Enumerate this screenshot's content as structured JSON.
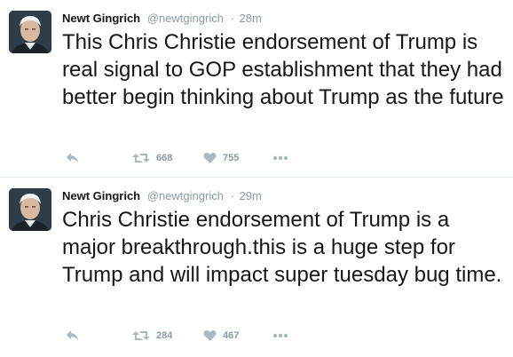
{
  "tweets": [
    {
      "fullname": "Newt Gingrich",
      "handle": "@newtgingrich",
      "separator": "·",
      "time": "28m",
      "text": "This Chris Christie endorsement of Trump is real signal to GOP establishment that they had better begin thinking about Trump as the future",
      "retweets": "668",
      "likes": "755"
    },
    {
      "fullname": "Newt Gingrich",
      "handle": "@newtgingrich",
      "separator": "·",
      "time": "29m",
      "text": "Chris Christie endorsement of Trump is a major breakthrough.this is a huge step for Trump and will impact super tuesday bug time.",
      "retweets": "284",
      "likes": "467"
    }
  ],
  "icons": {
    "reply": "reply-icon",
    "retweet": "retweet-icon",
    "like": "heart-icon",
    "more": "more-icon"
  },
  "colors": {
    "action_icon": "#aab8c2",
    "meta_text": "#8899a6",
    "divider": "#e1e8ed"
  }
}
